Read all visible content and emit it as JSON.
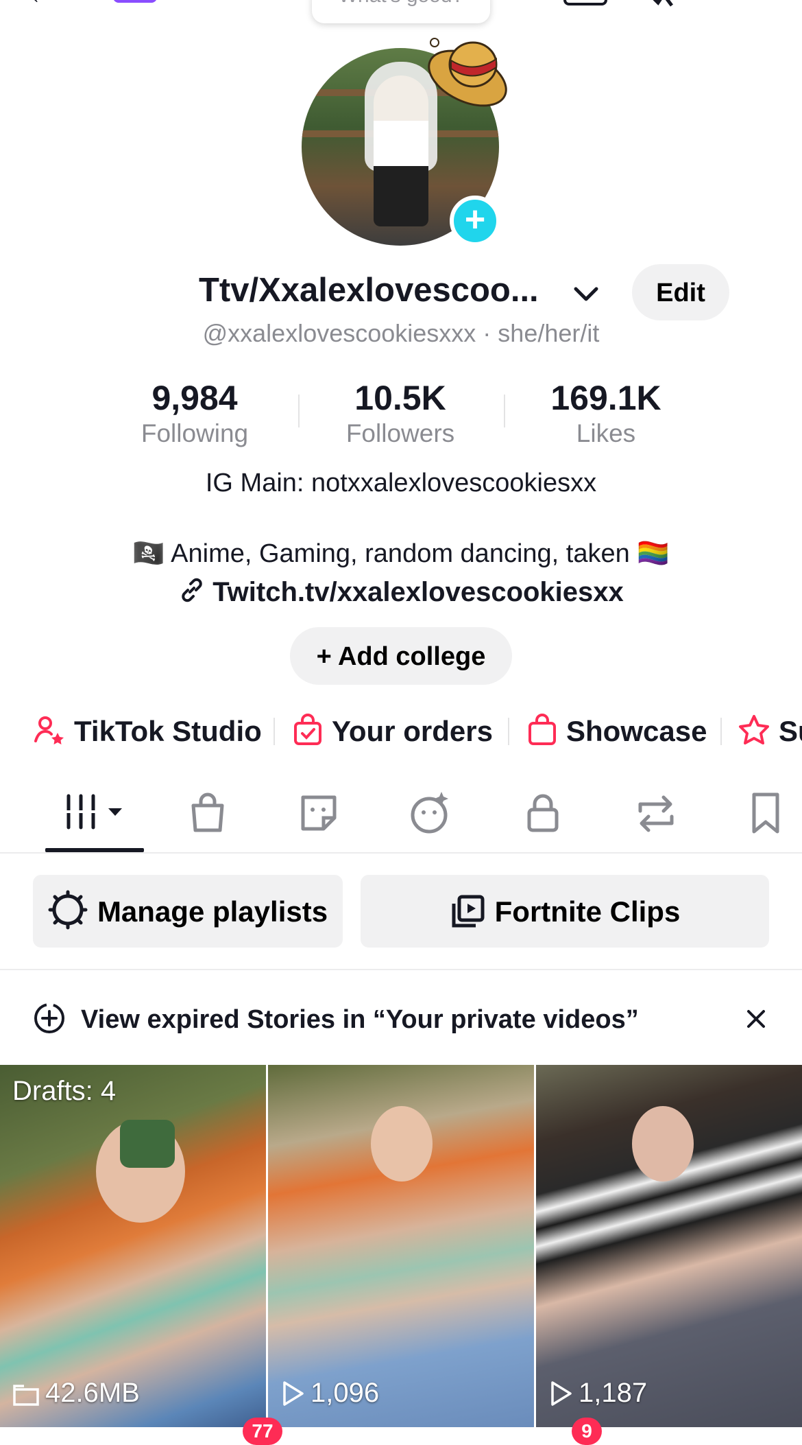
{
  "top": {
    "bubble_text": "What's good?"
  },
  "profile": {
    "display_name": "Ttv/Xxalexlovescoo...",
    "edit_label": "Edit",
    "handle_line": "@xxalexlovescookiesxxx · she/her/it"
  },
  "stats": [
    {
      "value": "9,984",
      "label": "Following"
    },
    {
      "value": "10.5K",
      "label": "Followers"
    },
    {
      "value": "169.1K",
      "label": "Likes"
    }
  ],
  "bio": {
    "line1": "IG Main: notxxalexlovescookiesxx",
    "line2": "🏴‍☠️ Anime, Gaming, random dancing, taken 🏳️‍🌈",
    "link": "Twitch.tv/xxalexlovescookiesxx"
  },
  "add_college_label": "+ Add college",
  "shortcuts": [
    {
      "label": "TikTok Studio",
      "icon": "person-star-icon"
    },
    {
      "label": "Your orders",
      "icon": "bag-check-icon"
    },
    {
      "label": "Showcase",
      "icon": "bag-icon"
    },
    {
      "label": "Su",
      "icon": "star-icon"
    }
  ],
  "tabs": [
    "videos-grid-icon",
    "shop-bag-icon",
    "sticker-icon",
    "ai-face-icon",
    "lock-icon",
    "repost-icon",
    "bookmark-icon"
  ],
  "pills": {
    "manage": "Manage playlists",
    "playlist": "Fortnite Clips"
  },
  "notice": "View expired Stories in “Your private videos”",
  "videos": [
    {
      "top_label": "Drafts: 4",
      "bottom_label": "42.6MB",
      "bottom_icon": "folder-icon"
    },
    {
      "top_label": "",
      "bottom_label": "1,096",
      "bottom_icon": "play-icon"
    },
    {
      "top_label": "",
      "bottom_label": "1,187",
      "bottom_icon": "play-icon"
    }
  ],
  "bottom_badges": [
    "77",
    "9"
  ],
  "colors": {
    "accent_red": "#fe2c55",
    "accent_cyan": "#20d5ec",
    "text_primary": "#161823",
    "text_secondary": "#8a8b91"
  }
}
